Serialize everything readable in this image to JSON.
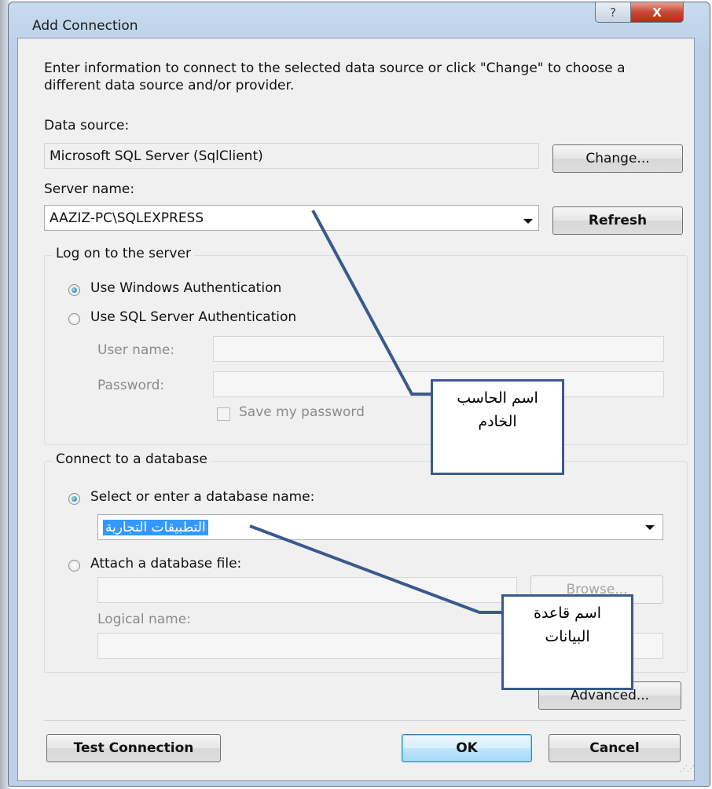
{
  "window": {
    "title": "Add Connection",
    "help_glyph": "?",
    "close_glyph": "X"
  },
  "intro": "Enter information to connect to the selected data source or click \"Change\" to choose a different data source and/or provider.",
  "data_source": {
    "label": "Data source:",
    "value": "Microsoft SQL Server (SqlClient)",
    "change_button": "Change..."
  },
  "server": {
    "label": "Server name:",
    "value": "AAZIZ-PC\\SQLEXPRESS",
    "refresh_button": "Refresh"
  },
  "logon": {
    "group_title": "Log on to the server",
    "windows_auth": "Use Windows Authentication",
    "sql_auth": "Use SQL Server Authentication",
    "user_label": "User name:",
    "password_label": "Password:",
    "save_password": "Save my password",
    "selected": "windows"
  },
  "database": {
    "group_title": "Connect to a database",
    "select_option": "Select or enter a database name:",
    "db_value": "التطبيقات التجارية",
    "attach_option": "Attach a database file:",
    "browse_button": "Browse...",
    "logical_label": "Logical name:",
    "selected": "select"
  },
  "advanced_button": "Advanced...",
  "footer": {
    "test_button": "Test Connection",
    "ok_button": "OK",
    "cancel_button": "Cancel"
  },
  "annotations": {
    "server_note_line1": "اسم الحاسب",
    "server_note_line2": "الخادم",
    "db_note_line1": "اسم قاعدة",
    "db_note_line2": "البيانات",
    "line_color": "#3a5a8c"
  }
}
